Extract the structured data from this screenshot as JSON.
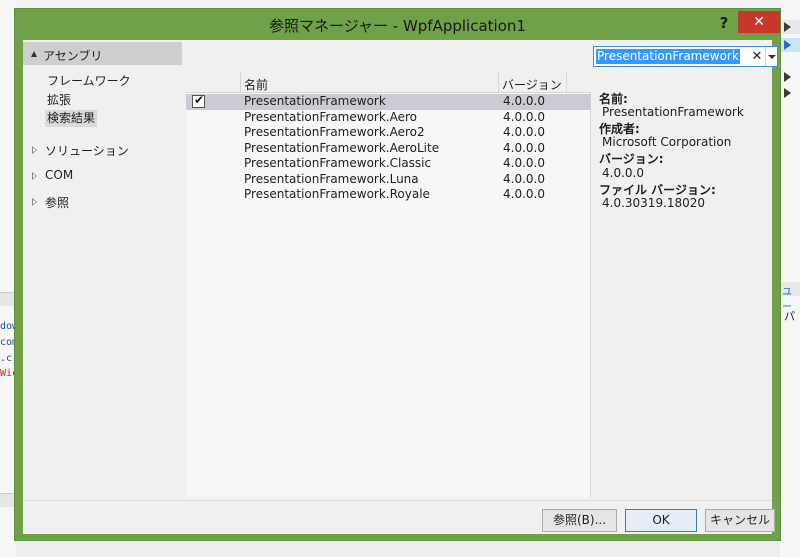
{
  "dialog": {
    "title": "参照マネージャー - WpfApplication1",
    "help_label": "?",
    "close_label": "✕"
  },
  "nav": {
    "assemblies": "アセンブリ",
    "sub_items": [
      "フレームワーク",
      "拡張",
      "検索結果"
    ],
    "groups": [
      "ソリューション",
      "COM",
      "参照"
    ]
  },
  "search": {
    "value": "PresentationFramework",
    "clear": "✕"
  },
  "list": {
    "columns": {
      "name": "名前",
      "version": "バージョン"
    },
    "rows": [
      {
        "name": "PresentationFramework",
        "version": "4.0.0.0",
        "checked": true
      },
      {
        "name": "PresentationFramework.Aero",
        "version": "4.0.0.0",
        "checked": false
      },
      {
        "name": "PresentationFramework.Aero2",
        "version": "4.0.0.0",
        "checked": false
      },
      {
        "name": "PresentationFramework.AeroLite",
        "version": "4.0.0.0",
        "checked": false
      },
      {
        "name": "PresentationFramework.Classic",
        "version": "4.0.0.0",
        "checked": false
      },
      {
        "name": "PresentationFramework.Luna",
        "version": "4.0.0.0",
        "checked": false
      },
      {
        "name": "PresentationFramework.Royale",
        "version": "4.0.0.0",
        "checked": false
      }
    ],
    "check_mark": "✔"
  },
  "details": {
    "name_label": "名前:",
    "name_value": "PresentationFramework",
    "author_label": "作成者:",
    "author_value": "Microsoft Corporation",
    "version_label": "バージョン:",
    "version_value": "4.0.0.0",
    "file_version_label": "ファイル バージョン:",
    "file_version_value": "4.0.30319.18020"
  },
  "buttons": {
    "browse": "参照(B)...",
    "ok": "OK",
    "cancel": "キャンセル"
  },
  "background": {
    "code_lines": [
      "dow",
      "com",
      ".c",
      "Wic"
    ],
    "right_labels": [
      "ユー",
      "パ"
    ]
  },
  "colors": {
    "dialog_frame": "#6fa04a",
    "close_button": "#c7382c",
    "selection": "#3399ff"
  }
}
